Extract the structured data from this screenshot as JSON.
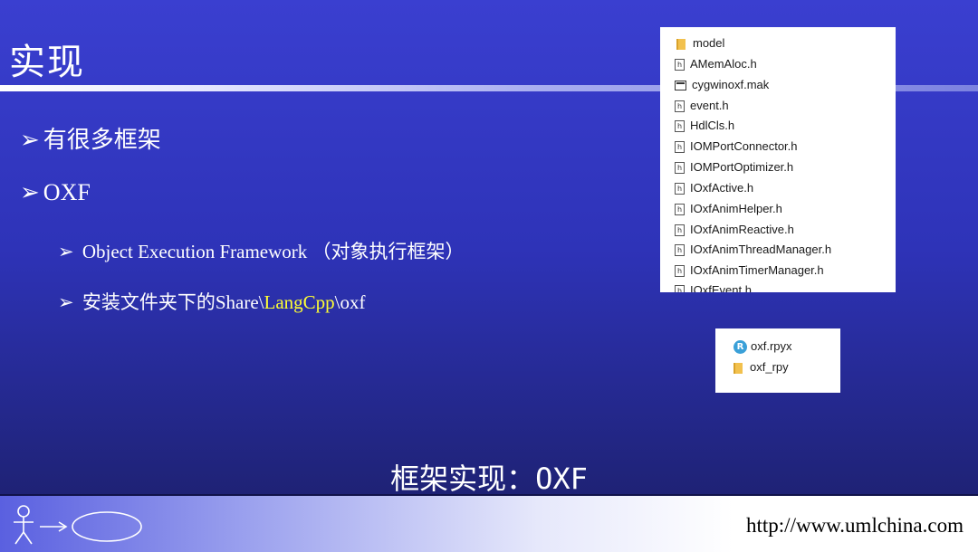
{
  "slide": {
    "title": "实现",
    "bullets": [
      {
        "arrow": "➢",
        "text": "有很多框架"
      },
      {
        "arrow": "➢",
        "text": "OXF"
      }
    ],
    "sub_bullets": [
      {
        "arrow": "➢",
        "text_en": "Object Execution Framework",
        "text_cn": "（对象执行框架）"
      },
      {
        "arrow": "➢",
        "text_cn": "安装文件夹下的",
        "path_a": "Share\\",
        "path_highlight": "LangCpp",
        "path_b": "\\oxf"
      }
    ],
    "caption": "框架实现：OXF",
    "footer_url": "http://www.umlchina.com"
  },
  "file_list": [
    {
      "name": "model",
      "icon": "folder-icon"
    },
    {
      "name": "AMemAloc.h",
      "icon": "header-file-icon"
    },
    {
      "name": "cygwinoxf.mak",
      "icon": "makefile-icon"
    },
    {
      "name": "event.h",
      "icon": "header-file-icon"
    },
    {
      "name": "HdlCls.h",
      "icon": "header-file-icon"
    },
    {
      "name": "IOMPortConnector.h",
      "icon": "header-file-icon"
    },
    {
      "name": "IOMPortOptimizer.h",
      "icon": "header-file-icon"
    },
    {
      "name": "IOxfActive.h",
      "icon": "header-file-icon"
    },
    {
      "name": "IOxfAnimHelper.h",
      "icon": "header-file-icon"
    },
    {
      "name": "IOxfAnimReactive.h",
      "icon": "header-file-icon"
    },
    {
      "name": "IOxfAnimThreadManager.h",
      "icon": "header-file-icon"
    },
    {
      "name": "IOxfAnimTimerManager.h",
      "icon": "header-file-icon"
    },
    {
      "name": "IOxfEvent.h",
      "icon": "header-file-icon"
    }
  ],
  "rpy_list": [
    {
      "name": "oxf.rpyx",
      "icon": "rhapsody-project-icon"
    },
    {
      "name": "oxf_rpy",
      "icon": "folder-icon"
    }
  ],
  "colors": {
    "highlight": "#ffff33",
    "background": "#2e33b8"
  }
}
